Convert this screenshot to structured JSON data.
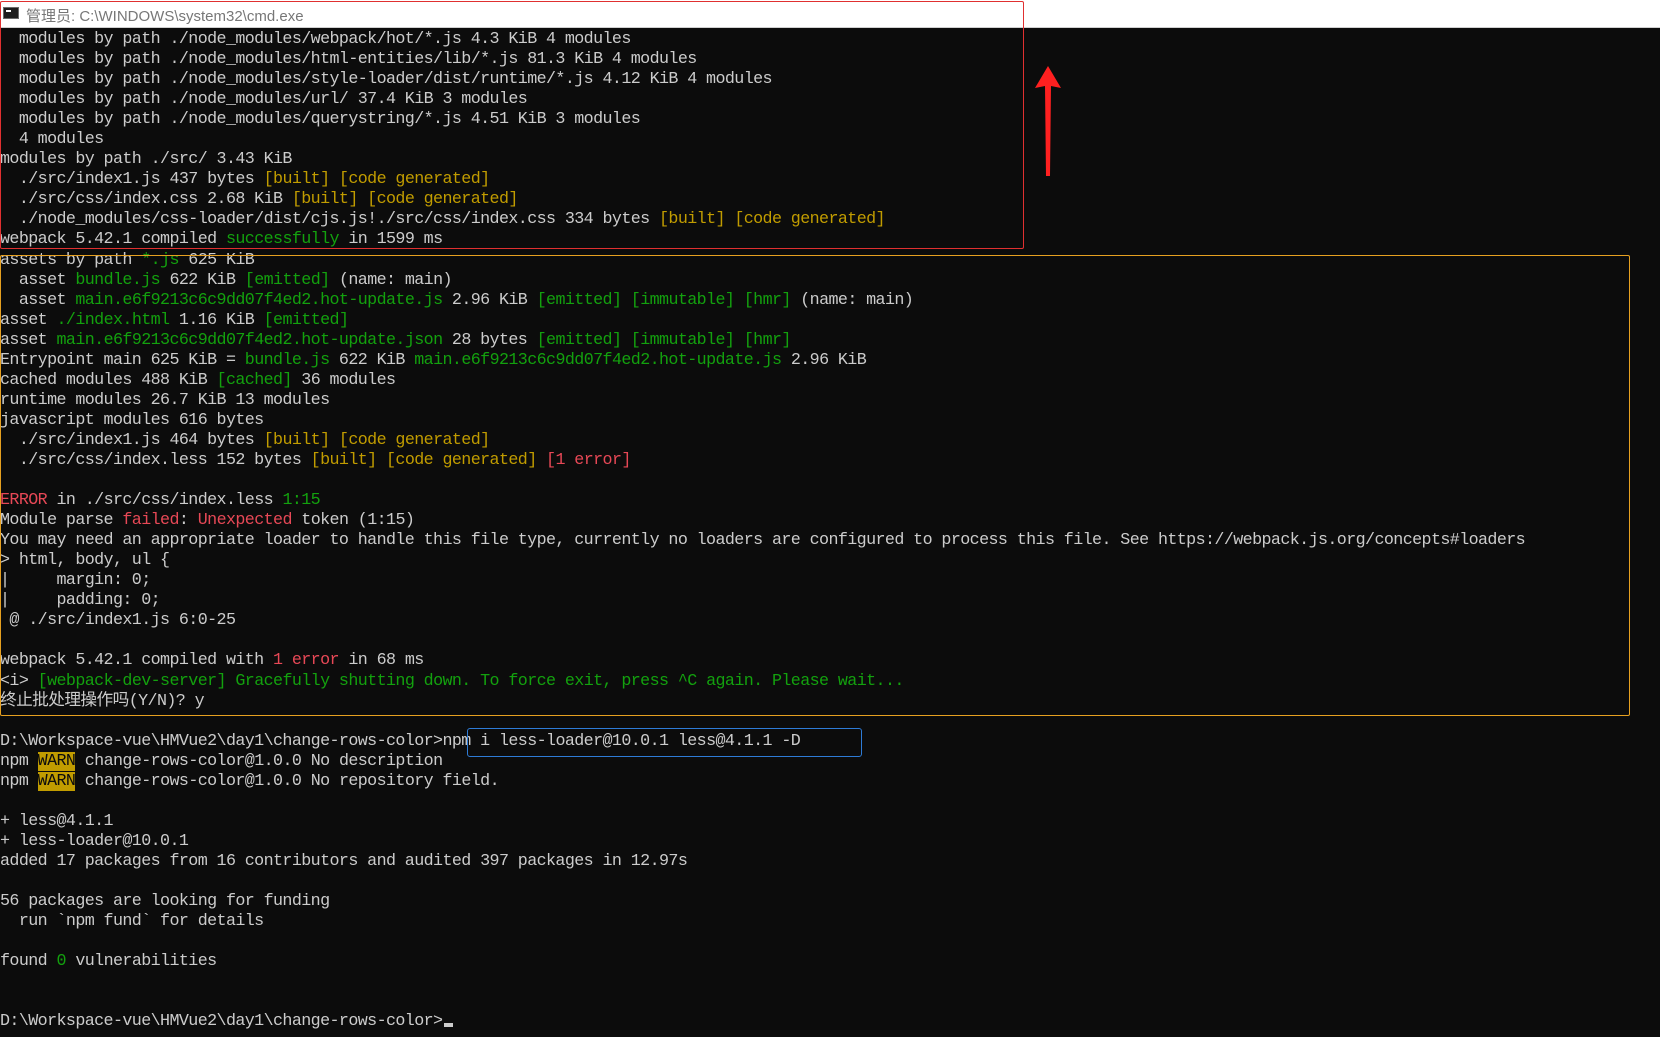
{
  "window": {
    "title": "管理员: C:\\WINDOWS\\system32\\cmd.exe",
    "icon": "console-icon"
  },
  "terminal": {
    "prompt": "D:\\Workspace-vue\\HMVue2\\day1\\change-rows-color>",
    "lines": [
      [
        {
          "t": "  modules by path ./node_modules/webpack/hot/*.js 4.3 KiB 4 modules",
          "c": ""
        }
      ],
      [
        {
          "t": "  modules by path ./node_modules/html-entities/lib/*.js 81.3 KiB 4 modules",
          "c": ""
        }
      ],
      [
        {
          "t": "  modules by path ./node_modules/style-loader/dist/runtime/*.js 4.12 KiB 4 modules",
          "c": ""
        }
      ],
      [
        {
          "t": "  modules by path ./node_modules/url/ 37.4 KiB 3 modules",
          "c": ""
        }
      ],
      [
        {
          "t": "  modules by path ./node_modules/querystring/*.js 4.51 KiB 3 modules",
          "c": ""
        }
      ],
      [
        {
          "t": "  4 modules",
          "c": ""
        }
      ],
      [
        {
          "t": "modules by path ./src/ 3.43 KiB",
          "c": ""
        }
      ],
      [
        {
          "t": "  ./src/index1.js 437 bytes ",
          "c": ""
        },
        {
          "t": "[built] [code generated]",
          "c": "y"
        }
      ],
      [
        {
          "t": "  ./src/css/index.css 2.68 KiB ",
          "c": ""
        },
        {
          "t": "[built] [code generated]",
          "c": "y"
        }
      ],
      [
        {
          "t": "  ./node_modules/css-loader/dist/cjs.js!./src/css/index.css 334 bytes ",
          "c": ""
        },
        {
          "t": "[built] [code generated]",
          "c": "y"
        }
      ],
      [
        {
          "t": "webpack 5.42.1 compiled ",
          "c": ""
        },
        {
          "t": "successfully",
          "c": "g"
        },
        {
          "t": " in 1599 ms",
          "c": ""
        }
      ],
      [
        {
          "t": "assets by path ",
          "c": ""
        },
        {
          "t": "*.js",
          "c": "g"
        },
        {
          "t": " 625 KiB",
          "c": ""
        }
      ],
      [
        {
          "t": "  asset ",
          "c": ""
        },
        {
          "t": "bundle.js",
          "c": "g"
        },
        {
          "t": " 622 KiB ",
          "c": ""
        },
        {
          "t": "[emitted]",
          "c": "g"
        },
        {
          "t": " (name: main)",
          "c": ""
        }
      ],
      [
        {
          "t": "  asset ",
          "c": ""
        },
        {
          "t": "main.e6f9213c6c9dd07f4ed2.hot-update.js",
          "c": "g"
        },
        {
          "t": " 2.96 KiB ",
          "c": ""
        },
        {
          "t": "[emitted] [immutable] [hmr]",
          "c": "g"
        },
        {
          "t": " (name: main)",
          "c": ""
        }
      ],
      [
        {
          "t": "asset ",
          "c": ""
        },
        {
          "t": "./index.html",
          "c": "g"
        },
        {
          "t": " 1.16 KiB ",
          "c": ""
        },
        {
          "t": "[emitted]",
          "c": "g"
        }
      ],
      [
        {
          "t": "asset ",
          "c": ""
        },
        {
          "t": "main.e6f9213c6c9dd07f4ed2.hot-update.json",
          "c": "g"
        },
        {
          "t": " 28 bytes ",
          "c": ""
        },
        {
          "t": "[emitted] [immutable] [hmr]",
          "c": "g"
        }
      ],
      [
        {
          "t": "Entrypoint main 625 KiB = ",
          "c": ""
        },
        {
          "t": "bundle.js",
          "c": "g"
        },
        {
          "t": " 622 KiB ",
          "c": ""
        },
        {
          "t": "main.e6f9213c6c9dd07f4ed2.hot-update.js",
          "c": "g"
        },
        {
          "t": " 2.96 KiB",
          "c": ""
        }
      ],
      [
        {
          "t": "cached modules 488 KiB ",
          "c": ""
        },
        {
          "t": "[cached]",
          "c": "g"
        },
        {
          "t": " 36 modules",
          "c": ""
        }
      ],
      [
        {
          "t": "runtime modules 26.7 KiB 13 modules",
          "c": ""
        }
      ],
      [
        {
          "t": "javascript modules 616 bytes",
          "c": ""
        }
      ],
      [
        {
          "t": "  ./src/index1.js 464 bytes ",
          "c": ""
        },
        {
          "t": "[built] [code generated]",
          "c": "y"
        }
      ],
      [
        {
          "t": "  ./src/css/index.less 152 bytes ",
          "c": ""
        },
        {
          "t": "[built] [code generated]",
          "c": "y"
        },
        {
          "t": " ",
          "c": ""
        },
        {
          "t": "[1 error]",
          "c": "r"
        }
      ],
      [
        {
          "t": "",
          "c": ""
        }
      ],
      [
        {
          "t": "ERROR",
          "c": "r"
        },
        {
          "t": " in ./src/css/index.less ",
          "c": ""
        },
        {
          "t": "1:15",
          "c": "g"
        }
      ],
      [
        {
          "t": "Module parse ",
          "c": ""
        },
        {
          "t": "failed",
          "c": "r"
        },
        {
          "t": ": ",
          "c": ""
        },
        {
          "t": "Unexpected",
          "c": "r"
        },
        {
          "t": " token (1:15)",
          "c": ""
        }
      ],
      [
        {
          "t": "You may need an appropriate loader to handle this file type, currently no loaders are configured to process this file. See https://webpack.js.org/concepts#loaders",
          "c": ""
        }
      ],
      [
        {
          "t": "> html, body, ul {",
          "c": ""
        }
      ],
      [
        {
          "t": "|     margin: 0;",
          "c": ""
        }
      ],
      [
        {
          "t": "|     padding: 0;",
          "c": ""
        }
      ],
      [
        {
          "t": " @ ./src/index1.js 6:0-25",
          "c": ""
        }
      ],
      [
        {
          "t": "",
          "c": ""
        }
      ],
      [
        {
          "t": "webpack 5.42.1 compiled with ",
          "c": ""
        },
        {
          "t": "1 error",
          "c": "r"
        },
        {
          "t": " in 68 ms",
          "c": ""
        }
      ],
      [
        {
          "t": "<i> ",
          "c": ""
        },
        {
          "t": "[webpack-dev-server] Gracefully shutting down. To force exit, press ^C again. Please wait...",
          "c": "g"
        }
      ],
      [
        {
          "t": "终止批处理操作吗(Y/N)? y",
          "c": ""
        }
      ],
      [
        {
          "t": "",
          "c": ""
        }
      ],
      [
        {
          "t": "D:\\Workspace-vue\\HMVue2\\day1\\change-rows-color>",
          "c": ""
        },
        {
          "t": "npm i less-loader@10.0.1 less@4.1.1 -D",
          "c": ""
        }
      ],
      [
        {
          "t": "npm ",
          "c": ""
        },
        {
          "t": "WARN",
          "c": "warn"
        },
        {
          "t": " change-rows-color@1.0.0 No description",
          "c": ""
        }
      ],
      [
        {
          "t": "npm ",
          "c": ""
        },
        {
          "t": "WARN",
          "c": "warn"
        },
        {
          "t": " change-rows-color@1.0.0 No repository field.",
          "c": ""
        }
      ],
      [
        {
          "t": "",
          "c": ""
        }
      ],
      [
        {
          "t": "+ less@4.1.1",
          "c": ""
        }
      ],
      [
        {
          "t": "+ less-loader@10.0.1",
          "c": ""
        }
      ],
      [
        {
          "t": "added 17 packages from 16 contributors and audited 397 packages in 12.97s",
          "c": ""
        }
      ],
      [
        {
          "t": "",
          "c": ""
        }
      ],
      [
        {
          "t": "56 packages are looking for funding",
          "c": ""
        }
      ],
      [
        {
          "t": "  run `npm fund` for details",
          "c": ""
        }
      ],
      [
        {
          "t": "",
          "c": ""
        }
      ],
      [
        {
          "t": "found ",
          "c": ""
        },
        {
          "t": "0",
          "c": "g"
        },
        {
          "t": " vulnerabilities",
          "c": ""
        }
      ],
      [
        {
          "t": "",
          "c": ""
        }
      ],
      [
        {
          "t": "",
          "c": ""
        }
      ],
      [
        {
          "t": "D:\\Workspace-vue\\HMVue2\\day1\\change-rows-color>",
          "c": ""
        }
      ]
    ]
  },
  "colors": {
    "background": "#0c0c0c",
    "foreground": "#cccccc",
    "green": "#13a10e",
    "red": "#e74856",
    "yellow": "#c19c00",
    "annotation_red": "#e03030",
    "annotation_yellow": "#e6a020",
    "annotation_blue": "#2e7bd6"
  },
  "annotations": {
    "arrow_icon": "red-up-arrow-icon"
  }
}
